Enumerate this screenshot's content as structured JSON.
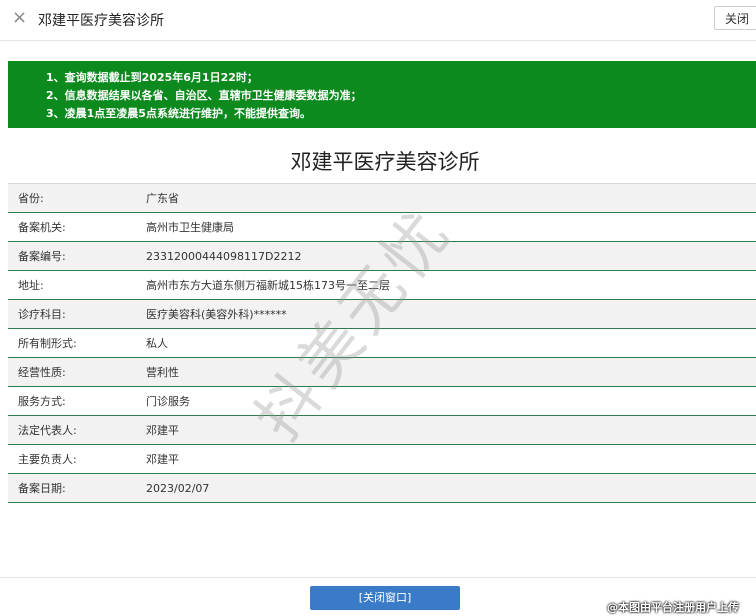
{
  "titlebar": {
    "title": "邓建平医疗美容诊所",
    "close_icon": "×",
    "close_button": "关闭"
  },
  "notice": {
    "lines": [
      "1、查询数据截止到2025年6月1日22时；",
      "2、信息数据结果以各省、自治区、直辖市卫生健康委数据为准；",
      "3、凌晨1点至凌晨5点系统进行维护，不能提供查询。"
    ]
  },
  "heading": "邓建平医疗美容诊所",
  "rows": [
    {
      "label": "省份:",
      "value": "广东省"
    },
    {
      "label": "备案机关:",
      "value": "高州市卫生健康局"
    },
    {
      "label": "备案编号:",
      "value": "23312000444098117D2212"
    },
    {
      "label": "地址:",
      "value": "高州市东方大道东侧万福新城15栋173号一至二层"
    },
    {
      "label": "诊疗科目:",
      "value": "医疗美容科(美容外科)******"
    },
    {
      "label": "所有制形式:",
      "value": "私人"
    },
    {
      "label": "经营性质:",
      "value": "营利性"
    },
    {
      "label": "服务方式:",
      "value": "门诊服务"
    },
    {
      "label": "法定代表人:",
      "value": "邓建平"
    },
    {
      "label": "主要负责人:",
      "value": "邓建平"
    },
    {
      "label": "备案日期:",
      "value": "2023/02/07"
    }
  ],
  "watermark": "抖美无忧",
  "footer": {
    "close_window": "[关闭窗口]",
    "upload_note": "@本图由平台注册用户上传"
  }
}
